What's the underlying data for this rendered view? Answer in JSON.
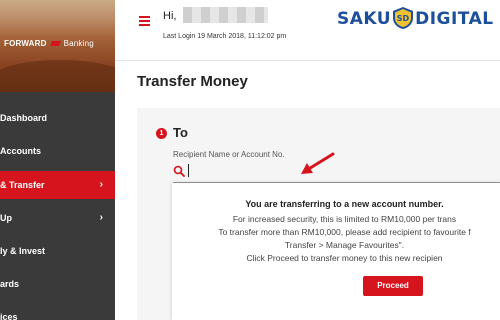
{
  "brand": {
    "name": "FORWARD",
    "suffix": "Banking"
  },
  "sidebar": {
    "items": [
      {
        "label": "Dashboard",
        "has_chevron": false,
        "active": false
      },
      {
        "label": "Accounts",
        "has_chevron": false,
        "active": false
      },
      {
        "label": "& Transfer",
        "has_chevron": true,
        "active": true
      },
      {
        "label": "Up",
        "has_chevron": true,
        "active": false
      },
      {
        "label": "ly & Invest",
        "has_chevron": false,
        "active": false
      },
      {
        "label": "ards",
        "has_chevron": false,
        "active": false
      },
      {
        "label": "ices",
        "has_chevron": false,
        "active": false
      }
    ]
  },
  "header": {
    "greeting": "Hi,",
    "last_login": "Last Login 19 March 2018, 11:12:02 pm"
  },
  "logo": {
    "left": "SAKU",
    "badge": "SD",
    "right": "DIGITAL"
  },
  "main": {
    "page_title": "Transfer Money",
    "step": {
      "number": "1",
      "label": "To"
    },
    "recipient_label": "Recipient Name or Account No.",
    "recipient_value": ""
  },
  "popup": {
    "heading": "You are transferring to a new account number.",
    "line1": "For increased security, this is limited to RM10,000 per trans",
    "line2": "To transfer more than RM10,000, please add recipient to favourite f",
    "line3": "Transfer > Manage Favourites\".",
    "line4": "Click Proceed to transfer money to this new recipien",
    "button": "Proceed"
  },
  "colors": {
    "accent": "#d6141e",
    "sidebar_bg": "#3a3a3a",
    "logo_blue": "#1e4f9c"
  }
}
